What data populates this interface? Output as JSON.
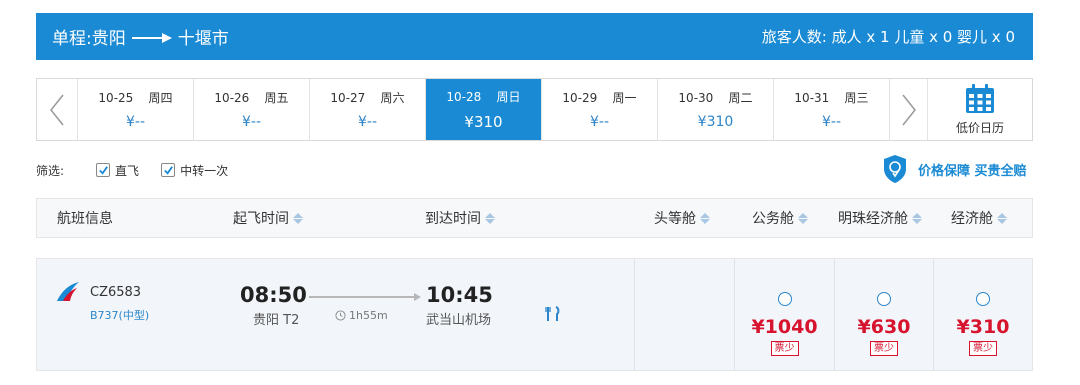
{
  "header": {
    "trip_type": "单程:",
    "origin": "贵阳",
    "destination": "十堰市",
    "passengers": "旅客人数: 成人 x 1 儿童 x 0 婴儿 x 0"
  },
  "date_strip": {
    "dates": [
      {
        "date": "10-25",
        "weekday": "周四",
        "price": "¥--",
        "active": false
      },
      {
        "date": "10-26",
        "weekday": "周五",
        "price": "¥--",
        "active": false
      },
      {
        "date": "10-27",
        "weekday": "周六",
        "price": "¥--",
        "active": false
      },
      {
        "date": "10-28",
        "weekday": "周日",
        "price": "¥310",
        "active": true
      },
      {
        "date": "10-29",
        "weekday": "周一",
        "price": "¥--",
        "active": false
      },
      {
        "date": "10-30",
        "weekday": "周二",
        "price": "¥310",
        "active": false
      },
      {
        "date": "10-31",
        "weekday": "周三",
        "price": "¥--",
        "active": false
      }
    ],
    "calendar_label": "低价日历"
  },
  "filter": {
    "label": "筛选:",
    "options": [
      {
        "label": "直飞",
        "checked": true
      },
      {
        "label": "中转一次",
        "checked": true
      }
    ],
    "guarantee": "价格保障 买贵全赔"
  },
  "table_header": {
    "flight_info": "航班信息",
    "depart_time": "起飞时间",
    "arrive_time": "到达时间",
    "first_class": "头等舱",
    "business": "公务舱",
    "pearl_economy": "明珠经济舱",
    "economy": "经济舱"
  },
  "flight": {
    "number": "CZ6583",
    "aircraft": "B737(中型)",
    "depart_time": "08:50",
    "depart_airport": "贵阳 T2",
    "duration": "1h55m",
    "arrive_time": "10:45",
    "arrive_airport": "武当山机场",
    "fares": [
      {
        "price": "¥1040",
        "tag": "票少"
      },
      {
        "price": "¥630",
        "tag": "票少"
      },
      {
        "price": "¥310",
        "tag": "票少"
      }
    ]
  },
  "colors": {
    "brand_blue": "#1a8ad4",
    "price_red": "#d8132e"
  },
  "icons": {
    "prev": "chevron-left-icon",
    "next": "chevron-right-icon",
    "calendar": "calendar-icon",
    "shield": "shield-icon",
    "clock": "clock-icon",
    "meal": "meal-icon",
    "airline": "china-southern-logo"
  }
}
